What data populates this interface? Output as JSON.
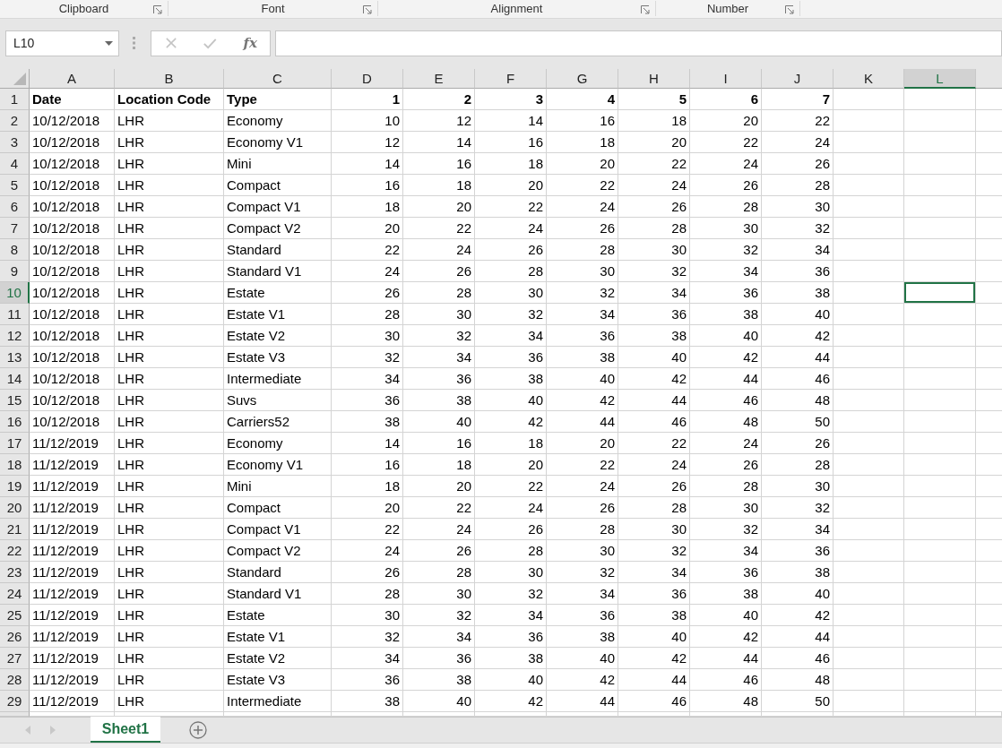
{
  "ribbon_groups": [
    {
      "label": "Clipboard"
    },
    {
      "label": "Font"
    },
    {
      "label": "Alignment"
    },
    {
      "label": "Number"
    }
  ],
  "formula_bar": {
    "name_box": "L10",
    "function_label": "fx"
  },
  "columns": [
    {
      "label": "A",
      "selected": false
    },
    {
      "label": "B",
      "selected": false
    },
    {
      "label": "C",
      "selected": false
    },
    {
      "label": "D",
      "selected": false
    },
    {
      "label": "E",
      "selected": false
    },
    {
      "label": "F",
      "selected": false
    },
    {
      "label": "G",
      "selected": false
    },
    {
      "label": "H",
      "selected": false
    },
    {
      "label": "I",
      "selected": false
    },
    {
      "label": "J",
      "selected": false
    },
    {
      "label": "K",
      "selected": false
    },
    {
      "label": "L",
      "selected": true
    }
  ],
  "rows": [
    {
      "number": "1",
      "selected": false,
      "header": true,
      "cells": [
        "Date",
        "Location Code",
        "Type",
        "1",
        "2",
        "3",
        "4",
        "5",
        "6",
        "7"
      ]
    },
    {
      "number": "2",
      "selected": false,
      "cells": [
        "10/12/2018",
        "LHR",
        "Economy",
        "10",
        "12",
        "14",
        "16",
        "18",
        "20",
        "22"
      ]
    },
    {
      "number": "3",
      "selected": false,
      "cells": [
        "10/12/2018",
        "LHR",
        "Economy V1",
        "12",
        "14",
        "16",
        "18",
        "20",
        "22",
        "24"
      ]
    },
    {
      "number": "4",
      "selected": false,
      "cells": [
        "10/12/2018",
        "LHR",
        "Mini",
        "14",
        "16",
        "18",
        "20",
        "22",
        "24",
        "26"
      ]
    },
    {
      "number": "5",
      "selected": false,
      "cells": [
        "10/12/2018",
        "LHR",
        "Compact",
        "16",
        "18",
        "20",
        "22",
        "24",
        "26",
        "28"
      ]
    },
    {
      "number": "6",
      "selected": false,
      "cells": [
        "10/12/2018",
        "LHR",
        "Compact V1",
        "18",
        "20",
        "22",
        "24",
        "26",
        "28",
        "30"
      ]
    },
    {
      "number": "7",
      "selected": false,
      "cells": [
        "10/12/2018",
        "LHR",
        "Compact V2",
        "20",
        "22",
        "24",
        "26",
        "28",
        "30",
        "32"
      ]
    },
    {
      "number": "8",
      "selected": false,
      "cells": [
        "10/12/2018",
        "LHR",
        "Standard",
        "22",
        "24",
        "26",
        "28",
        "30",
        "32",
        "34"
      ]
    },
    {
      "number": "9",
      "selected": false,
      "cells": [
        "10/12/2018",
        "LHR",
        "Standard V1",
        "24",
        "26",
        "28",
        "30",
        "32",
        "34",
        "36"
      ]
    },
    {
      "number": "10",
      "selected": true,
      "cells": [
        "10/12/2018",
        "LHR",
        "Estate",
        "26",
        "28",
        "30",
        "32",
        "34",
        "36",
        "38"
      ]
    },
    {
      "number": "11",
      "selected": false,
      "cells": [
        "10/12/2018",
        "LHR",
        "Estate V1",
        "28",
        "30",
        "32",
        "34",
        "36",
        "38",
        "40"
      ]
    },
    {
      "number": "12",
      "selected": false,
      "cells": [
        "10/12/2018",
        "LHR",
        "Estate V2",
        "30",
        "32",
        "34",
        "36",
        "38",
        "40",
        "42"
      ]
    },
    {
      "number": "13",
      "selected": false,
      "cells": [
        "10/12/2018",
        "LHR",
        "Estate V3",
        "32",
        "34",
        "36",
        "38",
        "40",
        "42",
        "44"
      ]
    },
    {
      "number": "14",
      "selected": false,
      "cells": [
        "10/12/2018",
        "LHR",
        "Intermediate",
        "34",
        "36",
        "38",
        "40",
        "42",
        "44",
        "46"
      ]
    },
    {
      "number": "15",
      "selected": false,
      "cells": [
        "10/12/2018",
        "LHR",
        "Suvs",
        "36",
        "38",
        "40",
        "42",
        "44",
        "46",
        "48"
      ]
    },
    {
      "number": "16",
      "selected": false,
      "cells": [
        "10/12/2018",
        "LHR",
        "Carriers52",
        "38",
        "40",
        "42",
        "44",
        "46",
        "48",
        "50"
      ]
    },
    {
      "number": "17",
      "selected": false,
      "cells": [
        "11/12/2019",
        "LHR",
        "Economy",
        "14",
        "16",
        "18",
        "20",
        "22",
        "24",
        "26"
      ]
    },
    {
      "number": "18",
      "selected": false,
      "cells": [
        "11/12/2019",
        "LHR",
        "Economy V1",
        "16",
        "18",
        "20",
        "22",
        "24",
        "26",
        "28"
      ]
    },
    {
      "number": "19",
      "selected": false,
      "cells": [
        "11/12/2019",
        "LHR",
        "Mini",
        "18",
        "20",
        "22",
        "24",
        "26",
        "28",
        "30"
      ]
    },
    {
      "number": "20",
      "selected": false,
      "cells": [
        "11/12/2019",
        "LHR",
        "Compact",
        "20",
        "22",
        "24",
        "26",
        "28",
        "30",
        "32"
      ]
    },
    {
      "number": "21",
      "selected": false,
      "cells": [
        "11/12/2019",
        "LHR",
        "Compact V1",
        "22",
        "24",
        "26",
        "28",
        "30",
        "32",
        "34"
      ]
    },
    {
      "number": "22",
      "selected": false,
      "cells": [
        "11/12/2019",
        "LHR",
        "Compact V2",
        "24",
        "26",
        "28",
        "30",
        "32",
        "34",
        "36"
      ]
    },
    {
      "number": "23",
      "selected": false,
      "cells": [
        "11/12/2019",
        "LHR",
        "Standard",
        "26",
        "28",
        "30",
        "32",
        "34",
        "36",
        "38"
      ]
    },
    {
      "number": "24",
      "selected": false,
      "cells": [
        "11/12/2019",
        "LHR",
        "Standard V1",
        "28",
        "30",
        "32",
        "34",
        "36",
        "38",
        "40"
      ]
    },
    {
      "number": "25",
      "selected": false,
      "cells": [
        "11/12/2019",
        "LHR",
        "Estate",
        "30",
        "32",
        "34",
        "36",
        "38",
        "40",
        "42"
      ]
    },
    {
      "number": "26",
      "selected": false,
      "cells": [
        "11/12/2019",
        "LHR",
        "Estate V1",
        "32",
        "34",
        "36",
        "38",
        "40",
        "42",
        "44"
      ]
    },
    {
      "number": "27",
      "selected": false,
      "cells": [
        "11/12/2019",
        "LHR",
        "Estate V2",
        "34",
        "36",
        "38",
        "40",
        "42",
        "44",
        "46"
      ]
    },
    {
      "number": "28",
      "selected": false,
      "cells": [
        "11/12/2019",
        "LHR",
        "Estate V3",
        "36",
        "38",
        "40",
        "42",
        "44",
        "46",
        "48"
      ]
    },
    {
      "number": "29",
      "selected": false,
      "cells": [
        "11/12/2019",
        "LHR",
        "Intermediate",
        "38",
        "40",
        "42",
        "44",
        "46",
        "48",
        "50"
      ]
    }
  ],
  "sheet_tabs": [
    {
      "label": "Sheet1",
      "selected": true
    }
  ]
}
